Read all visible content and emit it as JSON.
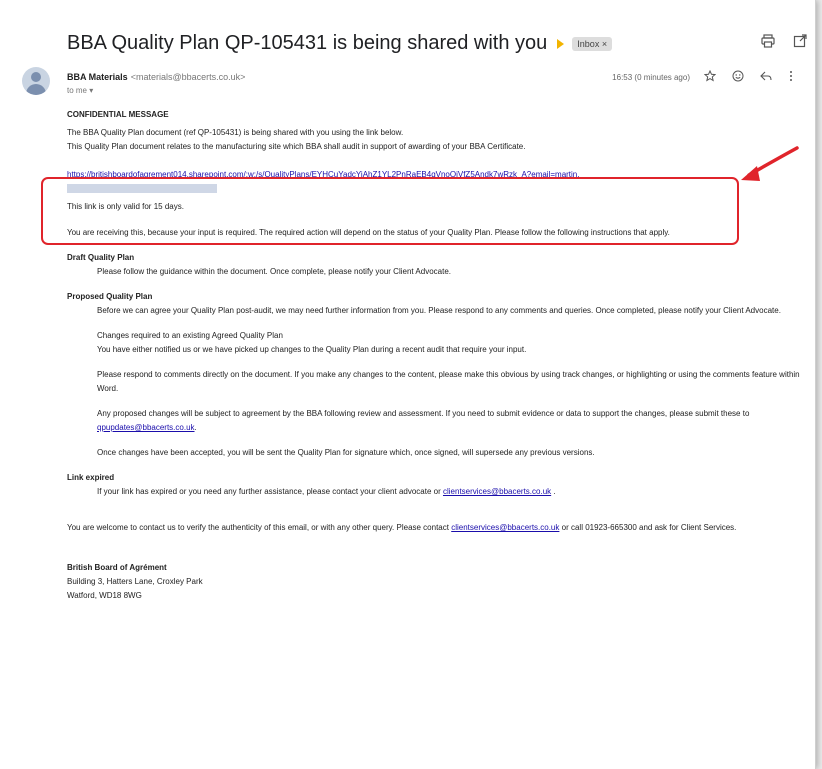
{
  "subject": "BBA Quality Plan QP-105431 is being shared with you",
  "label": "Inbox ×",
  "sender": {
    "name": "BBA Materials",
    "email": "<materials@bbacerts.co.uk>",
    "to": "to me ▾"
  },
  "time": "16:53 (0 minutes ago)",
  "body": {
    "confidential": "CONFIDENTIAL MESSAGE",
    "intro1": "The BBA Quality Plan document (ref QP-105431) is being shared with you using the link below.",
    "intro2": "This Quality Plan document relates to the manufacturing site which BBA shall audit in support of awarding of your BBA Certificate.",
    "link_url": "https://britishboardofagrement014.sharepoint.com/:w:/s/QualityPlans/EYHCuYadcYiAhZ1YL2PnRaEB4qVnoOiVfZ5Andk7wRzk_A?email=martin.",
    "link_valid": "This link is only valid for 15 days.",
    "receiving": "You are receiving this, because your input is required. The required action will depend on the status of your Quality Plan. Please follow the following instructions that apply.",
    "draft_heading": "Draft Quality Plan",
    "draft_text": "Please follow the guidance within the document. Once complete, please notify your Client Advocate.",
    "proposed_heading": "Proposed Quality Plan",
    "proposed_text": "Before we can agree your Quality Plan post-audit, we may need further information from you. Please respond to any comments and queries. Once completed, please notify your Client Advocate.",
    "changes_heading": "Changes required to an existing Agreed Quality Plan",
    "changes_text": "You have either notified us or we have picked up changes to the Quality Plan during a recent audit that require your input.",
    "respond_text": "Please respond to comments directly on the document. If you make any changes to the content, please make this obvious by using track changes, or highlighting or using the comments feature within Word.",
    "proposed_changes_text": "Any proposed changes will be subject to agreement by the BBA following review and assessment. If you need to submit evidence or data to support the changes, please submit these to",
    "qpupdates_email": "qpupdates@bbacerts.co.uk",
    "accepted_text": "Once changes have been accepted, you will be sent the Quality Plan for signature which, once signed, will supersede any previous versions.",
    "expired_heading": "Link expired",
    "expired_text": "If your link has expired or you need any further assistance, please contact your client advocate or",
    "clientservices_email": "clientservices@bbacerts.co.uk",
    "contact_text": "You are welcome to contact us to verify the authenticity of this email, or with any other query. Please contact",
    "contact_text2": "or call 01923-665300 and ask for Client Services.",
    "org_name": "British Board of Agrément",
    "address1": "Building 3, Hatters Lane, Croxley Park",
    "address2": "Watford, WD18 8WG"
  },
  "icons": [
    "print-icon",
    "open-in-new-window-icon",
    "star-icon",
    "emoji-icon",
    "reply-icon",
    "more-options-icon",
    "arrow-annotation"
  ],
  "colors": {
    "annotation": "#e0242b",
    "link": "#1a0dab",
    "important_marker": "#f2b400"
  }
}
